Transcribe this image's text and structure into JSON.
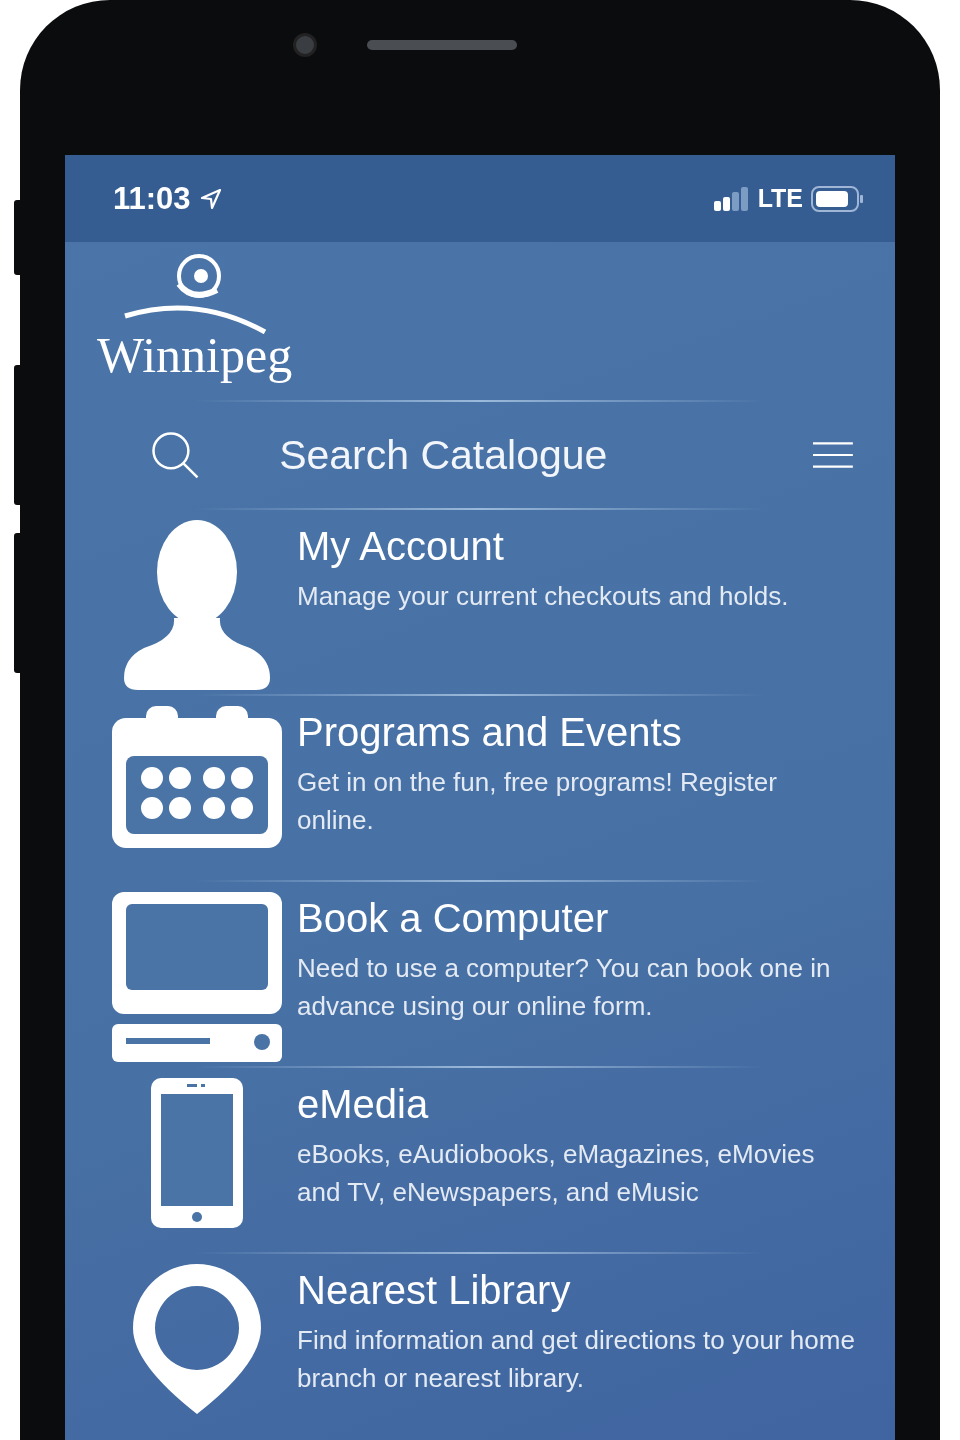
{
  "status_bar": {
    "time": "11:03",
    "network": "LTE"
  },
  "logo": {
    "text": "Winnipeg"
  },
  "search": {
    "placeholder": "Search Catalogue"
  },
  "menu_items": [
    {
      "kind": "person",
      "title": "My Account",
      "description": "Manage your current checkouts and holds."
    },
    {
      "kind": "calendar",
      "title": "Programs and Events",
      "description": "Get in on the fun, free programs! Register online."
    },
    {
      "kind": "computer",
      "title": "Book a Computer",
      "description": "Need to use a computer? You can book one in advance using our online form."
    },
    {
      "kind": "phone",
      "title": "eMedia",
      "description": "eBooks, eAudiobooks, eMagazines, eMovies and TV, eNewspapers, and eMusic"
    },
    {
      "kind": "pin",
      "title": "Nearest Library",
      "description": "Find information and get directions to your home branch or nearest library."
    }
  ]
}
